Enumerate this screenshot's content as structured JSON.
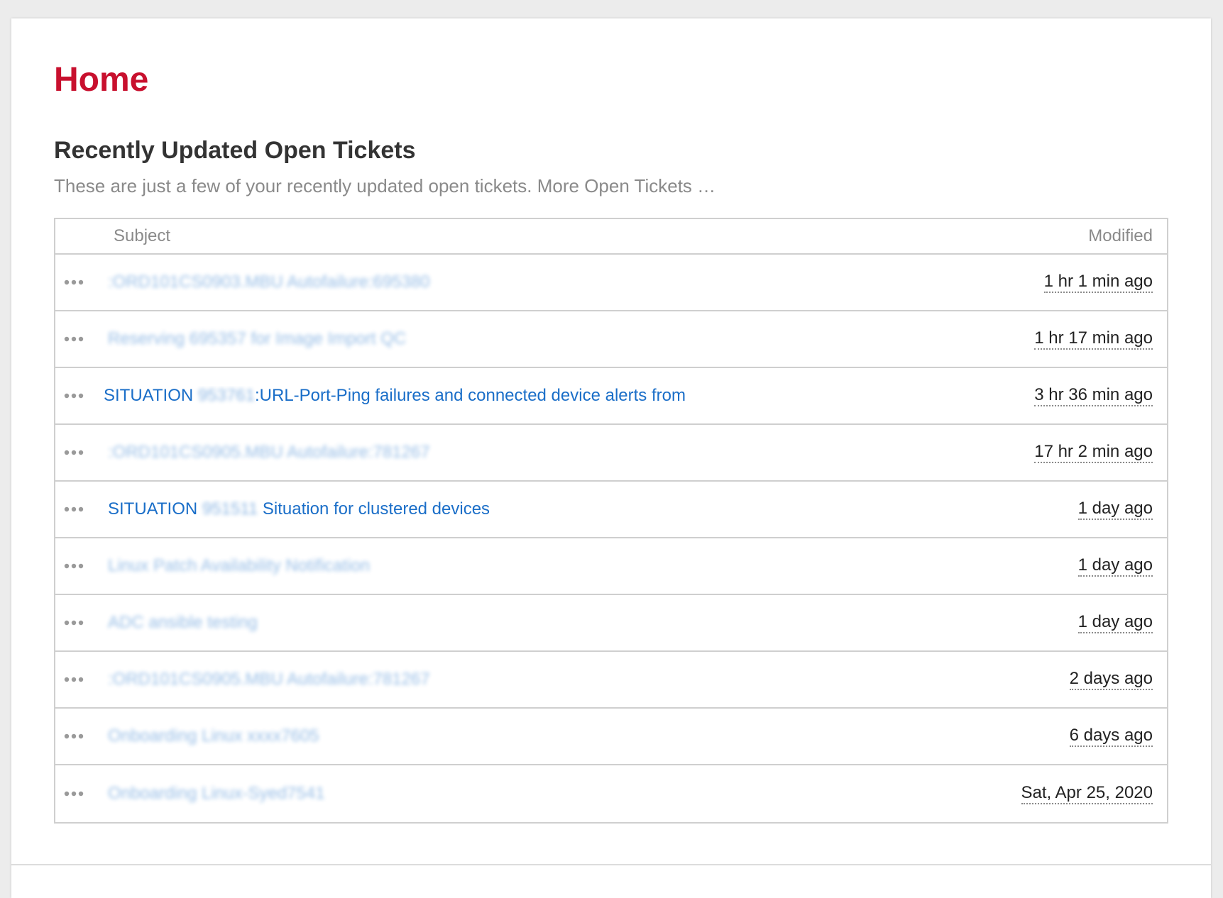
{
  "page": {
    "title": "Home"
  },
  "section": {
    "title": "Recently Updated Open Tickets",
    "description": "These are just a few of your recently updated open tickets.",
    "more_link": "More Open Tickets …"
  },
  "table": {
    "columns": {
      "subject": "Subject",
      "modified": "Modified"
    },
    "rows": [
      {
        "subject": ":ORD101CS0903.MBU Autofailure:695380",
        "modified": "1 hr 1 min ago",
        "redacted": true
      },
      {
        "subject": "Reserving 695357 for Image Import QC",
        "modified": "1 hr 17 min ago",
        "redacted": true
      },
      {
        "subject_prefix": "SITUATION",
        "subject_id": "953761",
        "subject_suffix": ":URL-Port-Ping failures and connected device alerts from",
        "modified": "3 hr 36 min ago",
        "redacted": false
      },
      {
        "subject": ":ORD101CS0905.MBU Autofailure:781267",
        "modified": "17 hr 2 min ago",
        "redacted": true
      },
      {
        "subject_prefix": "SITUATION",
        "subject_id": "951511",
        "subject_suffix": "Situation for clustered devices",
        "modified": "1 day ago",
        "redacted": false
      },
      {
        "subject": "Linux Patch Availability Notification",
        "modified": "1 day ago",
        "redacted": true
      },
      {
        "subject": "ADC ansible testing",
        "modified": "1 day ago",
        "redacted": true
      },
      {
        "subject": ":ORD101CS0905.MBU Autofailure:781267",
        "modified": "2 days ago",
        "redacted": true
      },
      {
        "subject": "Onboarding Linux xxxx7605",
        "modified": "6 days ago",
        "redacted": true
      },
      {
        "subject": "Onboarding Linux-Syed7541",
        "modified": "Sat, Apr 25, 2020",
        "redacted": true
      }
    ]
  },
  "icons": {
    "row_actions": "ellipsis-icon"
  },
  "colors": {
    "title": "#c8102e",
    "link": "#1a6ec8",
    "muted": "#8a8a8a",
    "border": "#cfcfcf"
  }
}
